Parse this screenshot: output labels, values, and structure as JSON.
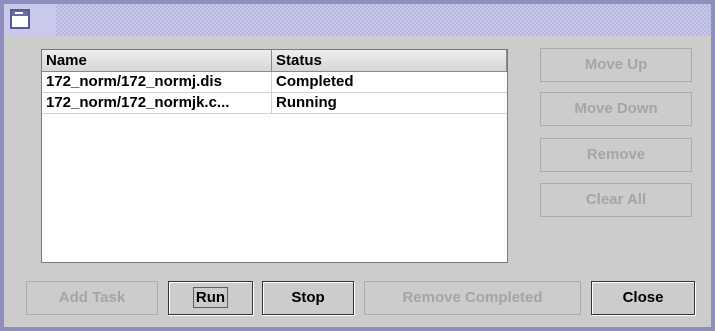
{
  "window": {
    "title": ""
  },
  "table": {
    "columns": [
      "Name",
      "Status"
    ],
    "rows": [
      {
        "name": "172_norm/172_normj.dis",
        "status": "Completed"
      },
      {
        "name": "172_norm/172_normjk.c...",
        "status": "Running"
      }
    ]
  },
  "side_buttons": {
    "move_up": "Move Up",
    "move_down": "Move Down",
    "remove": "Remove",
    "clear_all": "Clear All"
  },
  "bottom_buttons": {
    "add_task": "Add Task",
    "run": "Run",
    "stop": "Stop",
    "remove_completed": "Remove Completed",
    "close": "Close"
  },
  "colors": {
    "frame": "#8f8fbf",
    "panel": "#cccccc",
    "disabled_text": "#a5a5a5"
  }
}
